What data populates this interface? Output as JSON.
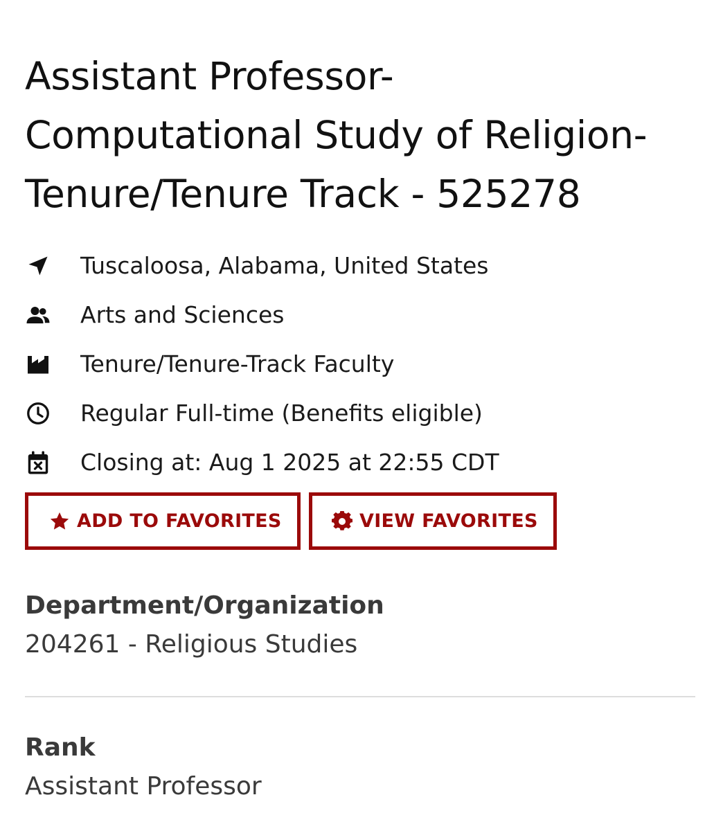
{
  "job": {
    "title_line1": "Assistant Professor-",
    "title_line2": "Computational Study of Religion-",
    "title_line3": "Tenure/Tenure Track - 525278"
  },
  "meta": {
    "location": "Tuscaloosa, Alabama, United States",
    "college": "Arts and Sciences",
    "category": "Tenure/Tenure-Track Faculty",
    "employment_type": "Regular Full-time (Benefits eligible)",
    "closing": "Closing at: Aug 1 2025 at 22:55 CDT"
  },
  "icons": {
    "location": "location-arrow-icon",
    "college": "users-icon",
    "category": "industry-icon",
    "employment_type": "clock-icon",
    "closing": "calendar-x-icon",
    "add_favorites": "star-icon",
    "view_favorites": "gear-icon"
  },
  "buttons": {
    "add_favorites": "ADD TO FAVORITES",
    "view_favorites": "VIEW FAVORITES"
  },
  "department": {
    "label": "Department/Organization",
    "value": "204261 - Religious Studies"
  },
  "rank": {
    "label": "Rank",
    "value": "Assistant Professor"
  },
  "colors": {
    "accent": "#9b0a0a",
    "text": "#1a1a1a",
    "secondary_text": "#3a3a3a",
    "divider": "#dddddd"
  }
}
